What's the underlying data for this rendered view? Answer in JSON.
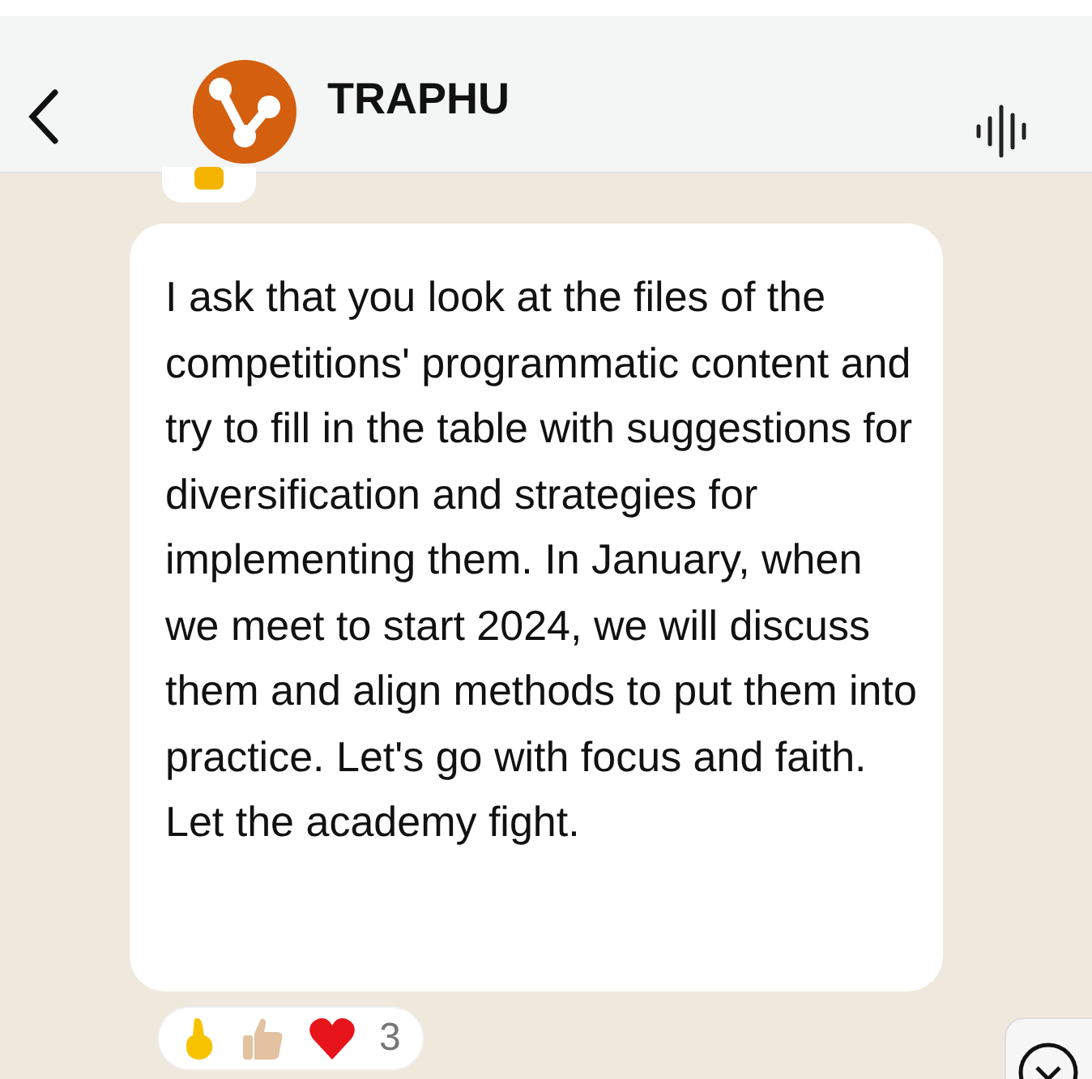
{
  "header": {
    "title": "TRAPHU"
  },
  "message": {
    "text": "I ask that you look at the files of the competitions' programmatic content and try to fill in the table with suggestions for diversification and strategies for implementing them. In January, when we meet to start 2024, we will discuss them and align methods to put them into practice. Let's go with focus and faith. Let the academy fight.",
    "reactions": [
      {
        "kind": "fingers"
      },
      {
        "kind": "thumb"
      },
      {
        "kind": "heart"
      }
    ],
    "reaction_count": "3"
  }
}
